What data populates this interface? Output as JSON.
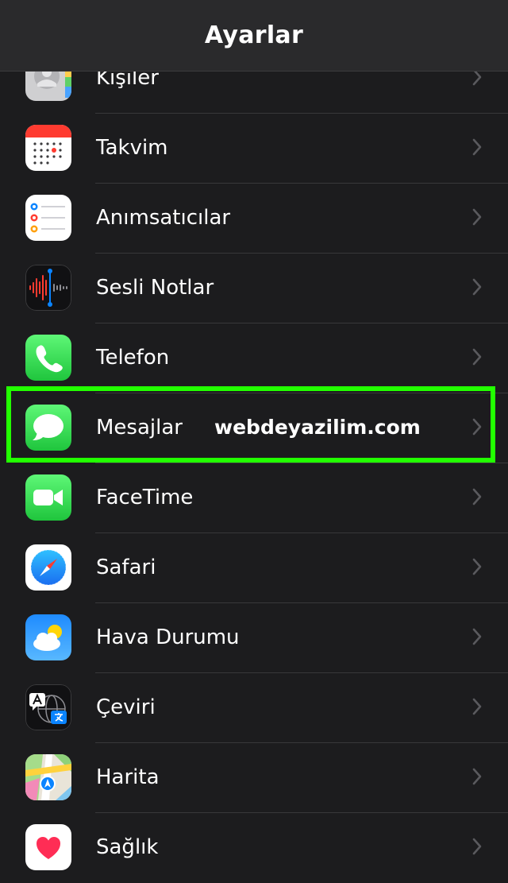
{
  "header": {
    "title": "Ayarlar"
  },
  "settings_rows": [
    {
      "label": "Kişiler",
      "icon": "contacts-icon"
    },
    {
      "label": "Takvim",
      "icon": "calendar-icon"
    },
    {
      "label": "Anımsatıcılar",
      "icon": "reminders-icon"
    },
    {
      "label": "Sesli Notlar",
      "icon": "voice-memos-icon"
    },
    {
      "label": "Telefon",
      "icon": "phone-icon"
    },
    {
      "label": "Mesajlar",
      "icon": "messages-icon"
    },
    {
      "label": "FaceTime",
      "icon": "facetime-icon"
    },
    {
      "label": "Safari",
      "icon": "safari-icon"
    },
    {
      "label": "Hava Durumu",
      "icon": "weather-icon"
    },
    {
      "label": "Çeviri",
      "icon": "translate-icon"
    },
    {
      "label": "Harita",
      "icon": "maps-icon"
    },
    {
      "label": "Sağlık",
      "icon": "health-icon"
    }
  ],
  "watermark": {
    "text": "webdeyazilim.com"
  },
  "highlight": {
    "row": "Mesajlar",
    "color": "#22ff00"
  },
  "colors": {
    "background": "#1c1c1e",
    "navbar": "#2a2a2c",
    "separator": "#38383a",
    "chevron": "#5a5a5e"
  }
}
